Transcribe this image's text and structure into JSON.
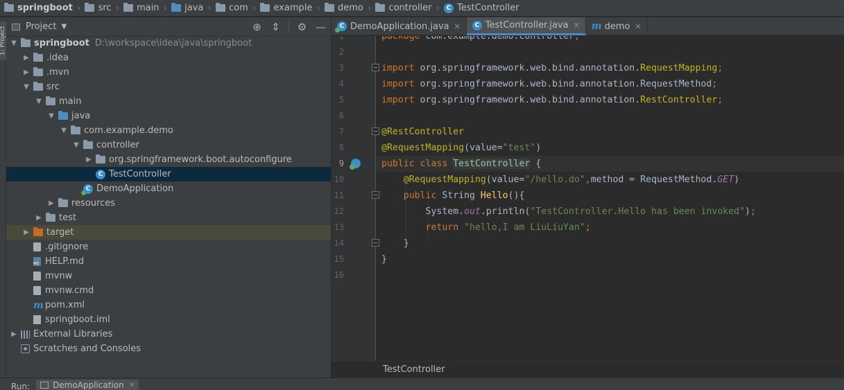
{
  "breadcrumb": [
    "springboot",
    "src",
    "main",
    "java",
    "com",
    "example",
    "demo",
    "controller",
    "TestController"
  ],
  "left_strip": {
    "label": "1: Project"
  },
  "project_panel": {
    "title": "Project",
    "tree": [
      {
        "label": "springboot",
        "path": "D:\\workspace\\idea\\java\\springboot",
        "level": 0,
        "arrow": "down",
        "icon": "folder-icon",
        "bold": true
      },
      {
        "label": ".idea",
        "level": 1,
        "arrow": "right",
        "icon": "folder-icon"
      },
      {
        "label": ".mvn",
        "level": 1,
        "arrow": "right",
        "icon": "folder-icon"
      },
      {
        "label": "src",
        "level": 1,
        "arrow": "down",
        "icon": "folder-icon"
      },
      {
        "label": "main",
        "level": 2,
        "arrow": "down",
        "icon": "folder-icon"
      },
      {
        "label": "java",
        "level": 3,
        "arrow": "down",
        "icon": "source-folder-icon"
      },
      {
        "label": "com.example.demo",
        "level": 4,
        "arrow": "down",
        "icon": "package-icon"
      },
      {
        "label": "controller",
        "level": 5,
        "arrow": "down",
        "icon": "package-icon"
      },
      {
        "label": "org.springframework.boot.autoconfigure",
        "level": 6,
        "arrow": "right",
        "icon": "package-icon"
      },
      {
        "label": "TestController",
        "level": 6,
        "arrow": "none",
        "icon": "class-icon",
        "selected": true
      },
      {
        "label": "DemoApplication",
        "level": 5,
        "arrow": "none",
        "icon": "spring-boot-app-icon"
      },
      {
        "label": "resources",
        "level": 3,
        "arrow": "right",
        "icon": "resources-folder-icon"
      },
      {
        "label": "test",
        "level": 2,
        "arrow": "right",
        "icon": "folder-icon"
      },
      {
        "label": "target",
        "level": 1,
        "arrow": "right",
        "icon": "excluded-folder-icon",
        "target": true
      },
      {
        "label": ".gitignore",
        "level": 1,
        "arrow": "none",
        "icon": "file-icon"
      },
      {
        "label": "HELP.md",
        "level": 1,
        "arrow": "none",
        "icon": "markdown-file-icon"
      },
      {
        "label": "mvnw",
        "level": 1,
        "arrow": "none",
        "icon": "file-icon"
      },
      {
        "label": "mvnw.cmd",
        "level": 1,
        "arrow": "none",
        "icon": "file-icon"
      },
      {
        "label": "pom.xml",
        "level": 1,
        "arrow": "none",
        "icon": "maven-icon"
      },
      {
        "label": "springboot.iml",
        "level": 1,
        "arrow": "none",
        "icon": "file-icon"
      },
      {
        "label": "External Libraries",
        "level": 0,
        "arrow": "right",
        "icon": "libraries-icon"
      },
      {
        "label": "Scratches and Consoles",
        "level": 0,
        "arrow": "none",
        "icon": "scratches-icon"
      }
    ]
  },
  "tabs": [
    {
      "label": "DemoApplication.java",
      "icon": "spring-boot-app-icon",
      "active": false
    },
    {
      "label": "TestController.java",
      "icon": "class-icon",
      "active": true
    },
    {
      "label": "demo",
      "icon": "maven-icon",
      "active": false
    }
  ],
  "editor": {
    "line_numbers": [
      "1",
      "2",
      "3",
      "4",
      "5",
      "6",
      "7",
      "8",
      "9",
      "10",
      "11",
      "12",
      "13",
      "14",
      "15",
      "16"
    ],
    "current_line": 9,
    "breadcrumb_footer": "TestController"
  },
  "run_bar": {
    "label": "Run:",
    "tab": "DemoApplication"
  },
  "colors": {
    "keyword": "#cc7832",
    "annotation": "#bbb529",
    "string": "#6a8759",
    "static_field": "#9876aa",
    "default_code": "#a9b7c6",
    "selection": "#0d293e"
  }
}
